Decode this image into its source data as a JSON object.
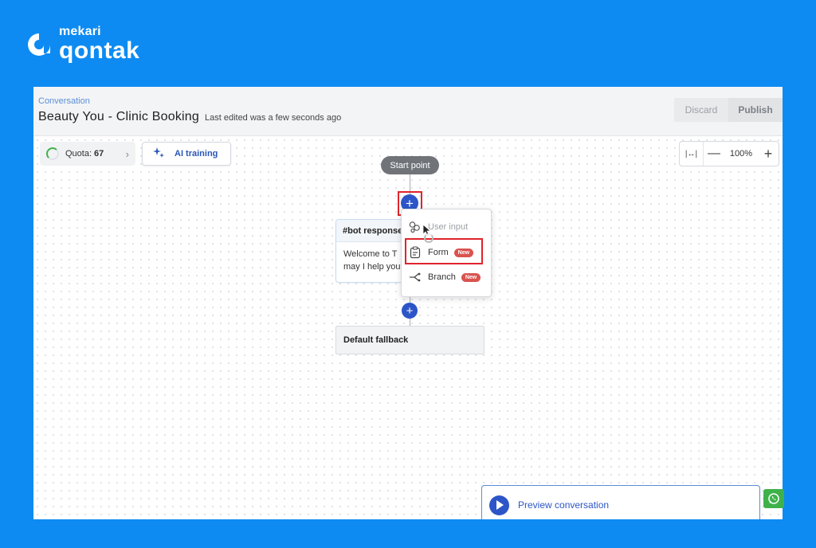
{
  "brand": {
    "small": "mekari",
    "big": "qontak"
  },
  "header": {
    "breadcrumb": "Conversation",
    "title": "Beauty You - Clinic Booking",
    "subtitle": "Last edited was a few seconds ago",
    "discard_label": "Discard",
    "publish_label": "Publish"
  },
  "toolbar": {
    "quota_label": "Quota:",
    "quota_value": "67",
    "ai_training_label": "AI training"
  },
  "zoom": {
    "level": "100%"
  },
  "flow": {
    "start_label": "Start point",
    "bot_card_title": "#bot response",
    "bot_card_line1": "Welcome to T",
    "bot_card_line2": "may I help you",
    "fallback_label": "Default fallback"
  },
  "menu": {
    "items": [
      {
        "label": "User input",
        "icon": "user-input-icon"
      },
      {
        "label": "Form",
        "icon": "form-icon",
        "badge": "New"
      },
      {
        "label": "Branch",
        "icon": "branch-icon",
        "badge": "New"
      }
    ]
  },
  "preview": {
    "label": "Preview conversation"
  },
  "colors": {
    "background": "#0d8bf2",
    "accent": "#2d55c8",
    "highlight": "#e0242b",
    "badge": "#d9534f",
    "whatsapp": "#3fb14b"
  }
}
